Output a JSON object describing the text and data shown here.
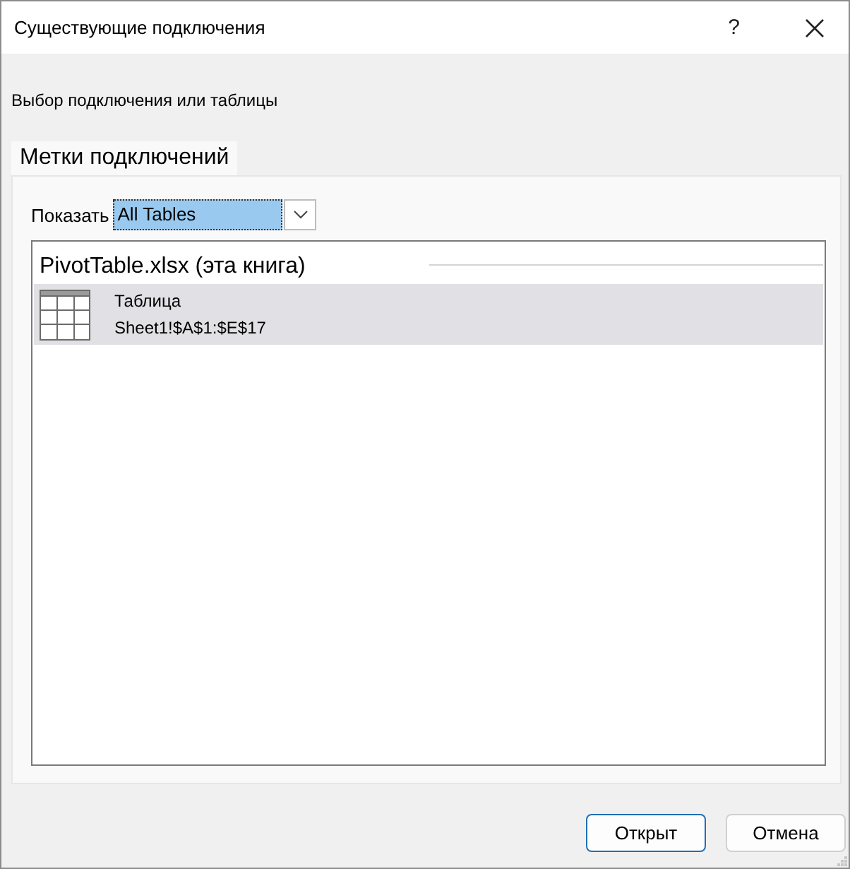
{
  "window": {
    "title": "Существующие подключения",
    "help_label": "?"
  },
  "instruction": "Выбор подключения или таблицы",
  "tabs": [
    {
      "label": "Метки подключений",
      "selected": true
    }
  ],
  "show_filter": {
    "label": "Показать",
    "value": "All Tables",
    "focused": true
  },
  "connection_list": {
    "groups": [
      {
        "title": "PivotTable.xlsx (эта книга)",
        "items": [
          {
            "kind": "table",
            "name": "Таблица",
            "range": "Sheet1!$A$1:$E$17",
            "selected": true
          }
        ]
      }
    ]
  },
  "buttons": [
    {
      "label": "Открыт",
      "default": true
    },
    {
      "label": "Отмена",
      "default": false
    }
  ]
}
